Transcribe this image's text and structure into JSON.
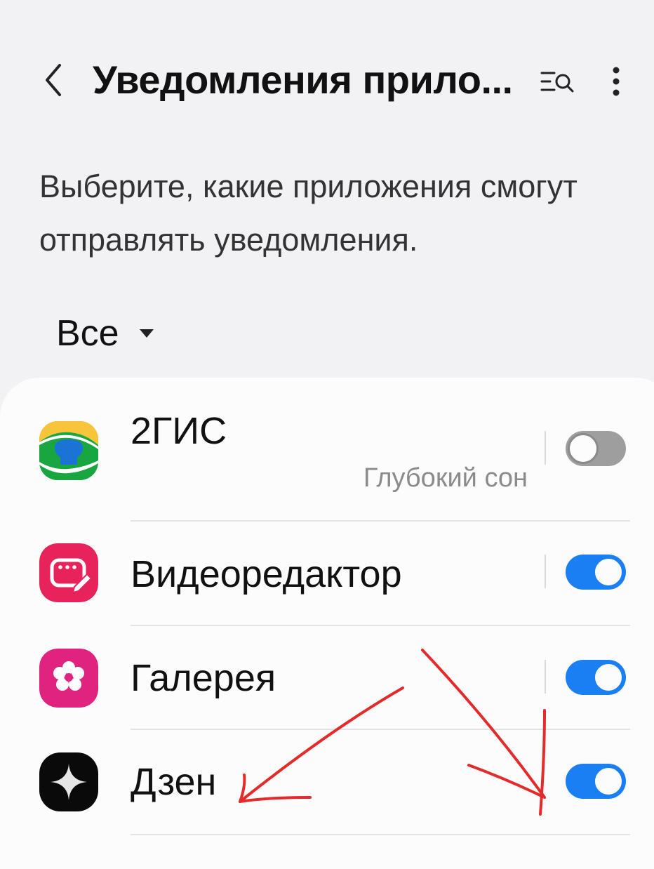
{
  "header": {
    "title": "Уведомления прило...",
    "back_icon": "chevron-left-icon",
    "search_icon": "list-search-icon",
    "more_icon": "more-vertical-icon"
  },
  "description": "Выберите, какие приложения смогут отправлять уведомления.",
  "filter": {
    "selected": "Все"
  },
  "apps": [
    {
      "name": "2ГИС",
      "subtitle": "Глубокий сон",
      "enabled": false,
      "icon": "2gis-icon"
    },
    {
      "name": "Видеоредактор",
      "enabled": true,
      "icon": "video-editor-icon"
    },
    {
      "name": "Галерея",
      "enabled": true,
      "icon": "gallery-icon"
    },
    {
      "name": "Дзен",
      "enabled": true,
      "icon": "dzen-icon"
    }
  ],
  "colors": {
    "accent": "#1a7ff3",
    "background": "#f2f2f4",
    "card": "#fcfcfc",
    "annotation": "#e32b2b"
  }
}
